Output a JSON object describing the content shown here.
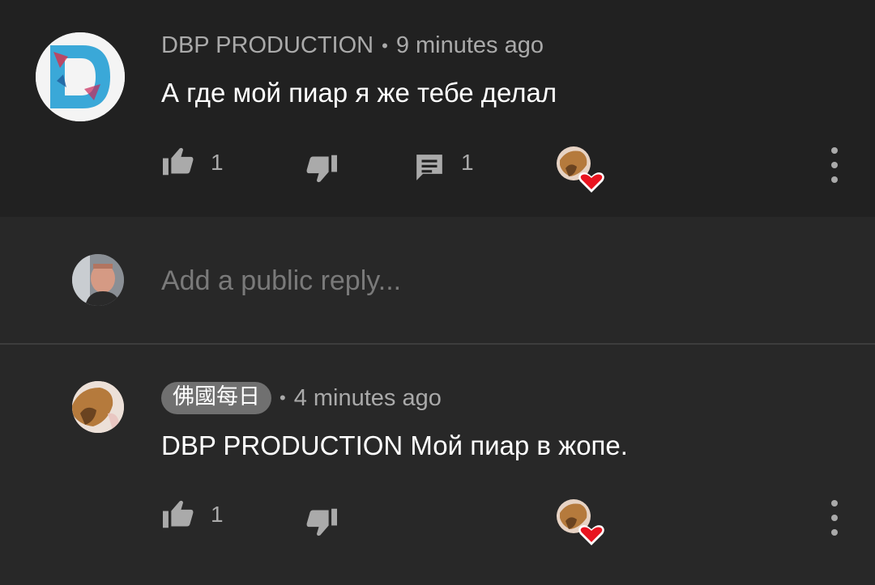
{
  "comment": {
    "author": "DBP PRODUCTION",
    "separator": "•",
    "time": "9 minutes ago",
    "text": "А где мой пиар я же тебе делал",
    "like_count": "1",
    "reply_count": "1",
    "icons": [
      "thumb-up-icon",
      "thumb-down-icon",
      "reply-icon",
      "heart-icon",
      "more-vert-icon"
    ]
  },
  "reply_box": {
    "placeholder": "Add a public reply..."
  },
  "reply": {
    "author": "佛國每日",
    "separator": "•",
    "time": "4 minutes ago",
    "text": "DBP PRODUCTION Мой пиар в жопе.",
    "like_count": "1",
    "icons": [
      "thumb-up-icon",
      "thumb-down-icon",
      "heart-icon",
      "more-vert-icon"
    ]
  },
  "colors": {
    "background_top": "#212121",
    "background": "#282828",
    "text_primary": "#ffffff",
    "text_secondary": "#aaaaaa",
    "heart": "#e8141f",
    "author_chip": "#707070"
  }
}
